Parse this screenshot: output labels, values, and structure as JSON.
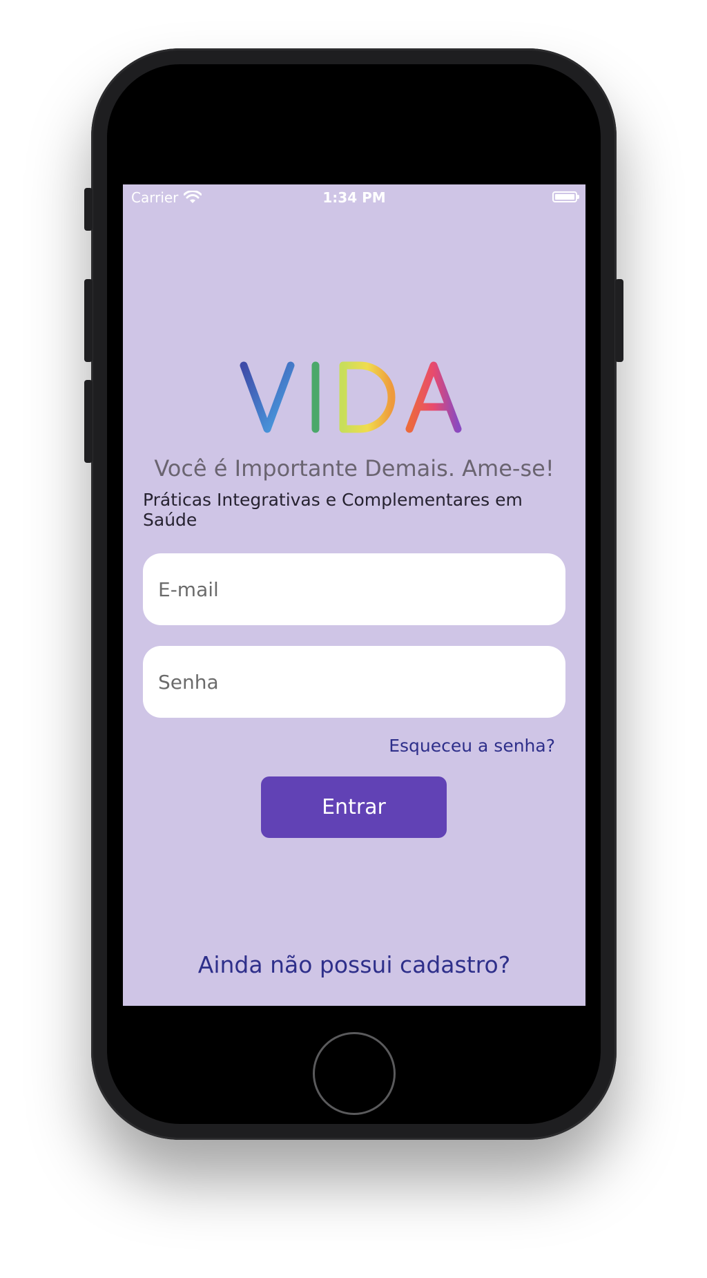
{
  "status_bar": {
    "carrier": "Carrier",
    "time": "1:34 PM",
    "wifi_icon": "wifi-icon",
    "battery_icon": "battery-icon"
  },
  "logo": {
    "text": "VIDA",
    "colors": [
      "#3f4ba8",
      "#4aa6e6",
      "#4ba86a",
      "#e8dc4a",
      "#e8813a",
      "#e84a6e",
      "#8a4ac0"
    ]
  },
  "tagline": "Você é Importante Demais. Ame-se!",
  "subtitle": "Práticas Integrativas e Complementares em Saúde",
  "form": {
    "email_placeholder": "E-mail",
    "password_placeholder": "Senha",
    "forgot_password": "Esqueceu a senha?",
    "login_button": "Entrar"
  },
  "register_link": "Ainda não possui cadastro?",
  "colors": {
    "background": "#cfc5e6",
    "primary": "#6142b5",
    "link": "#2e2f8a"
  }
}
